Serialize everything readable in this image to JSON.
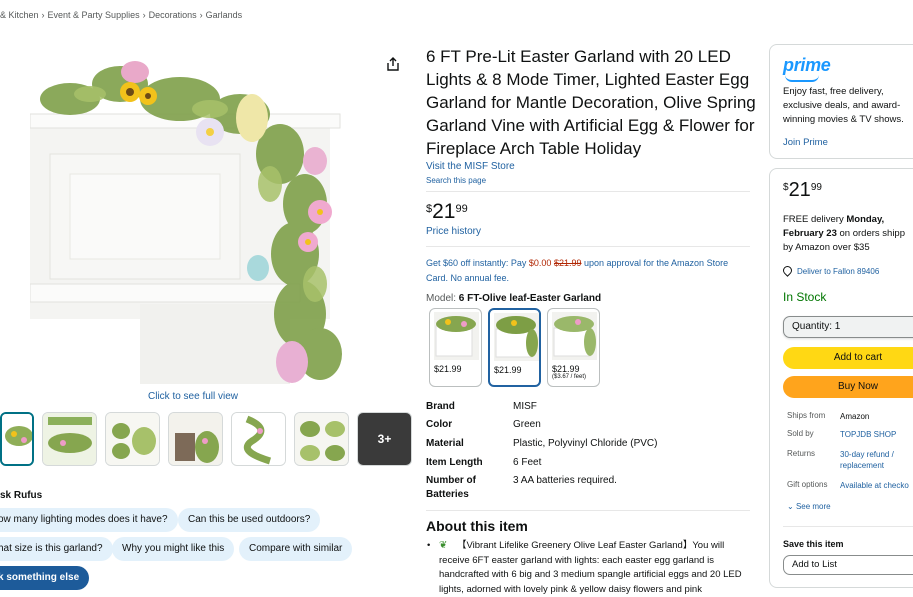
{
  "breadcrumb": [
    "& Kitchen",
    "Event & Party Supplies",
    "Decorations",
    "Garlands"
  ],
  "gallery": {
    "click_full": "Click to see full view",
    "more_label": "3+"
  },
  "rufus": {
    "title": "sk Rufus",
    "chips": [
      "ow many lighting modes does it have?",
      "Can this be used outdoors?",
      "hat size is this garland?",
      "Why you might like this",
      "Compare with similar",
      "k something else"
    ]
  },
  "product": {
    "title": "6 FT Pre-Lit Easter Garland with 20 LED Lights & 8 Mode Timer, Lighted Easter Egg Garland for Mantle Decoration, Olive Spring Garland Vine with Artificial Egg & Flower for Fireplace Arch Table Holiday",
    "store_link": "Visit the MISF Store",
    "search_page": "Search this page",
    "price_symbol": "$",
    "price_whole": "21",
    "price_fraction": "99",
    "price_history": "Price history",
    "promo_a": "Get $60 off instantly: Pay ",
    "promo_pay": "$0.00",
    "promo_strike": "$21.99",
    "promo_b": " upon approval for the Amazon Store Card. No annual fee.",
    "model_label": "Model: ",
    "model_value": "6 FT-Olive leaf-Easter Garland",
    "variants": [
      {
        "price": "$21.99",
        "unit": ""
      },
      {
        "price": "$21.99",
        "unit": ""
      },
      {
        "price": "$21.99",
        "unit": "($3.67 / feet)"
      }
    ],
    "specs": [
      {
        "key": "Brand",
        "value": "MISF"
      },
      {
        "key": "Color",
        "value": "Green"
      },
      {
        "key": "Material",
        "value": "Plastic, Polyvinyl Chloride (PVC)"
      },
      {
        "key": "Item Length",
        "value": "6 Feet"
      },
      {
        "key": "Number of Batteries",
        "value": "3 AA batteries required."
      }
    ],
    "about_title": "About this item",
    "about_first": "【Vibrant Lifelike Greenery Olive Leaf Easter Garland】You will receive 6FT easter garland with lights: each easter egg garland is handcrafted with 6 big and 3 medium spangle artificial eggs and 20 LED lights, adorned with lovely pink & yellow daisy flowers and pink"
  },
  "prime": {
    "logo": "prime",
    "description": "Enjoy fast, free delivery, exclusive deals, and award-winning movies & TV shows.",
    "join": "Join Prime"
  },
  "buybox": {
    "price_symbol": "$",
    "price_whole": "21",
    "price_fraction": "99",
    "delivery_line1": "FREE delivery ",
    "delivery_bold1": "Monday,",
    "delivery_bold2": "February 23",
    "delivery_line2": " on orders shipp",
    "delivery_line3": "by Amazon over $35",
    "deliver_to": "Deliver to Fallon 89406",
    "stock": "In Stock",
    "quantity": "Quantity: 1",
    "add_to_cart": "Add to cart",
    "buy_now": "Buy Now",
    "details": [
      {
        "key": "Ships from",
        "value": "Amazon",
        "link": false
      },
      {
        "key": "Sold by",
        "value": "TOPJDB SHOP",
        "link": true
      },
      {
        "key": "Returns",
        "value": "30-day refund / replacement",
        "link": true
      },
      {
        "key": "Gift options",
        "value": "Available at checko",
        "link": true
      }
    ],
    "see_more": "See more",
    "save_title": "Save this item",
    "add_to_list": "Add to List"
  },
  "colors": {
    "link": "#2162a1",
    "cart": "#ffd814",
    "buy": "#ffa41c",
    "stock": "#007600",
    "prime": "#1a98ff"
  }
}
